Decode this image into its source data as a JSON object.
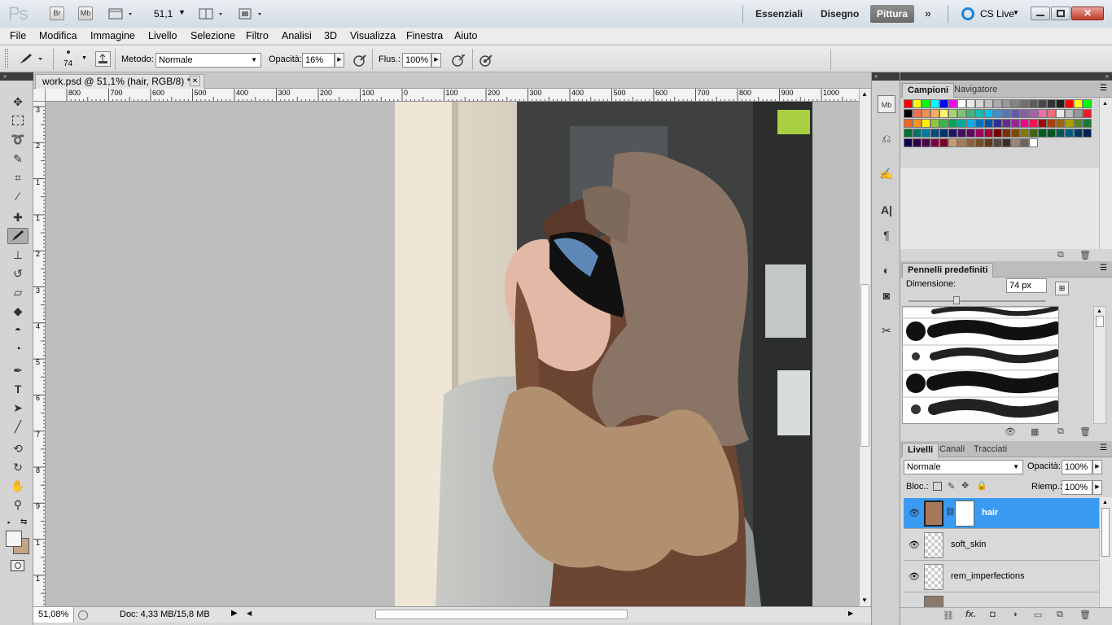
{
  "app": {
    "logo": "Ps",
    "bridge": "Br",
    "minibridge": "Mb",
    "zoom_value": "51,1",
    "workspaces": [
      "Essenziali",
      "Disegno",
      "Pittura"
    ],
    "active_workspace": "Pittura",
    "cs_live": "CS Live"
  },
  "menu": [
    "File",
    "Modifica",
    "Immagine",
    "Livello",
    "Selezione",
    "Filtro",
    "Analisi",
    "3D",
    "Visualizza",
    "Finestra",
    "Aiuto"
  ],
  "options": {
    "brush_size": "74",
    "method_label": "Metodo:",
    "method_value": "Normale",
    "opacity_label": "Opacità:",
    "opacity_value": "16%",
    "flow_label": "Flus.:",
    "flow_value": "100%"
  },
  "document": {
    "tab_title": "work.psd @ 51,1% (hair, RGB/8) *",
    "zoom_status": "51,08%",
    "doc_info": "Doc: 4,33 MB/15,8 MB",
    "hruler_labels": [
      "800",
      "700",
      "600",
      "500",
      "400",
      "300",
      "200",
      "100",
      "0",
      "100",
      "200",
      "300",
      "400",
      "500",
      "600",
      "700",
      "800",
      "900",
      "1000"
    ],
    "vruler_labels": [
      "3",
      "2",
      "1",
      "1",
      "2",
      "3",
      "4",
      "5",
      "6",
      "7",
      "8",
      "9",
      "1",
      "1"
    ]
  },
  "swatches_panel": {
    "tabs": [
      "Campioni",
      "Navigatore"
    ],
    "active_tab": "Campioni",
    "colors": [
      "#ff0000",
      "#ffff00",
      "#00ff00",
      "#00ffff",
      "#0000ff",
      "#ff00ff",
      "#ffffff",
      "#ebebeb",
      "#d6d6d6",
      "#c2c2c2",
      "#adadad",
      "#999999",
      "#858585",
      "#707070",
      "#5c5c5c",
      "#474747",
      "#333333",
      "#1f1f1f",
      "#ff0000",
      "#ffff00",
      "#00ff00",
      "#000000",
      "#f26c4f",
      "#f68e55",
      "#fbaf5d",
      "#fff467",
      "#acd372",
      "#7cc576",
      "#3bb878",
      "#1abbb4",
      "#00bff3",
      "#438ccb",
      "#5574b9",
      "#605ca8",
      "#855fa8",
      "#a763a8",
      "#f06ea9",
      "#f26d7d",
      "#e8e8e8",
      "#bdbdbd",
      "#999999",
      "#ed1c24",
      "#f26522",
      "#f7941d",
      "#fff200",
      "#8dc73f",
      "#39b54a",
      "#00a651",
      "#00a99d",
      "#00aeef",
      "#0072bc",
      "#0054a6",
      "#2e3192",
      "#662d91",
      "#92278f",
      "#ec008c",
      "#ed145b",
      "#9e0b0f",
      "#a0410d",
      "#a36209",
      "#aba000",
      "#598527",
      "#1a7b30",
      "#007236",
      "#00746b",
      "#0076a3",
      "#004b80",
      "#003471",
      "#1b1464",
      "#440e62",
      "#630460",
      "#9e005d",
      "#9e0039",
      "#790000",
      "#7b2e00",
      "#7d4900",
      "#827b00",
      "#406618",
      "#005e20",
      "#005826",
      "#005952",
      "#005b7f",
      "#003663",
      "#002157",
      "#0d004c",
      "#32004b",
      "#4b0049",
      "#7b0046",
      "#7a0026",
      "#c69c6d",
      "#a67c52",
      "#8c6239",
      "#754c24",
      "#603913",
      "#534741",
      "#362f2d",
      "#998675",
      "#736357",
      "#ffffff"
    ]
  },
  "brushes_panel": {
    "title": "Pennelli predefiniti",
    "size_label": "Dimensione:",
    "size_value": "74 px"
  },
  "layers_panel": {
    "tabs": [
      "Livelli",
      "Canali",
      "Tracciati"
    ],
    "active_tab": "Livelli",
    "blend_mode": "Normale",
    "opacity_label": "Opacità:",
    "opacity_value": "100%",
    "lock_label": "Bloc.:",
    "fill_label": "Riemp.:",
    "fill_value": "100%",
    "layers": [
      {
        "name": "hair",
        "selected": true
      },
      {
        "name": "soft_skin",
        "selected": false
      },
      {
        "name": "rem_imperfections",
        "selected": false
      }
    ]
  },
  "colors": {
    "selected_layer": "#3b9bf3",
    "active_workspace_bg": "#7a7a7a"
  }
}
